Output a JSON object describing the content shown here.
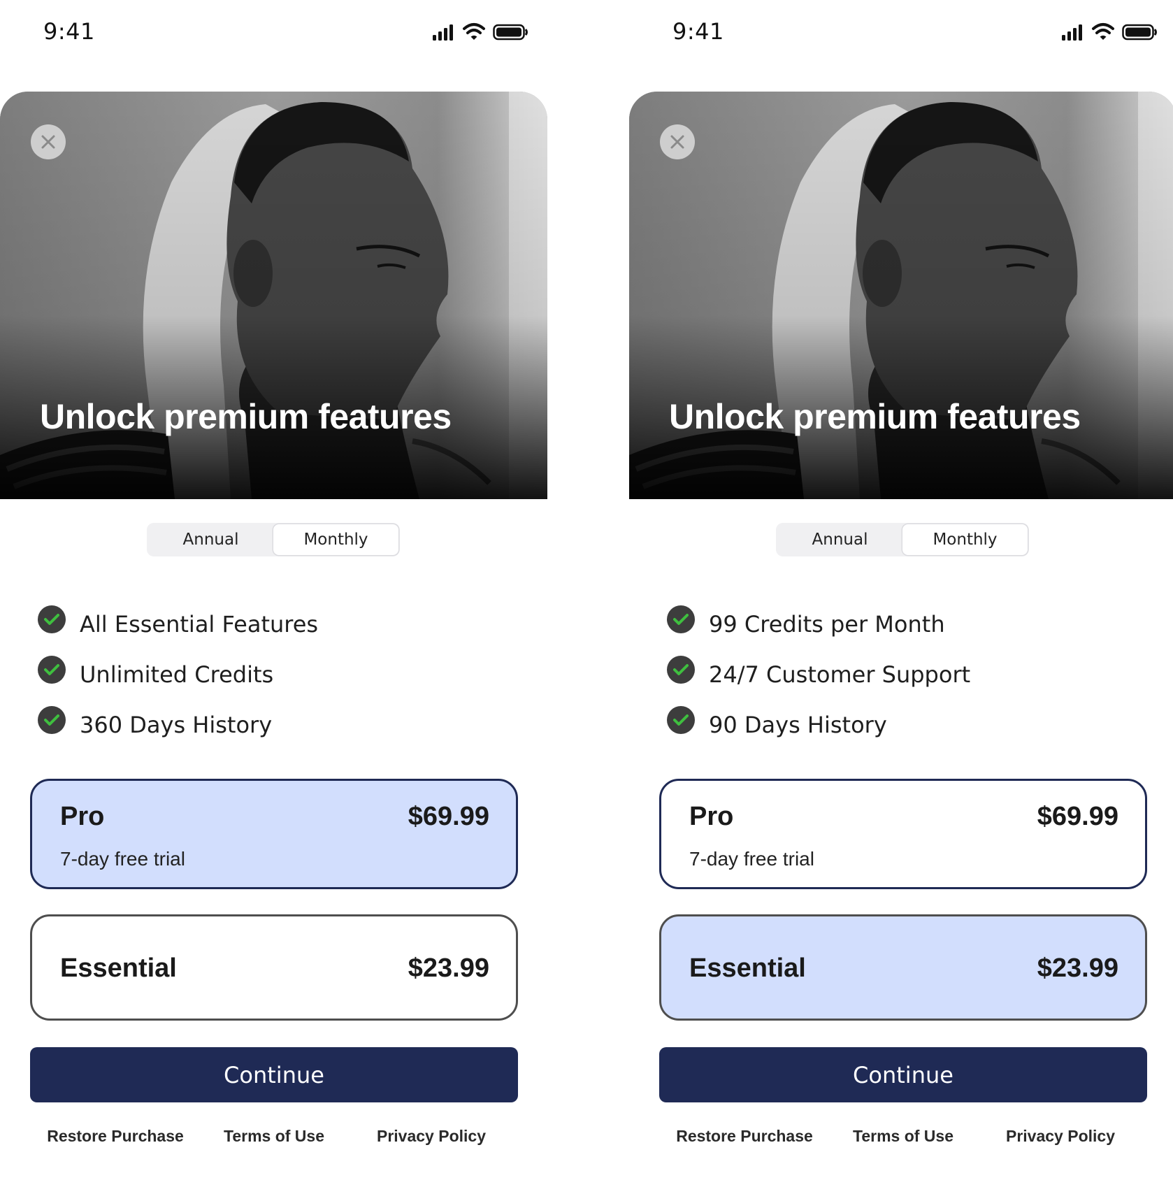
{
  "screens": [
    {
      "status": {
        "time": "9:41"
      },
      "hero_title": "Unlock premium features",
      "toggle": {
        "options": [
          "Annual",
          "Monthly"
        ],
        "selected": "Monthly"
      },
      "features": [
        "All Essential Features",
        "Unlimited Credits",
        "360 Days History"
      ],
      "plans": {
        "pro": {
          "name": "Pro",
          "price": "$69.99",
          "subtitle": "7-day free trial",
          "selected": true
        },
        "essential": {
          "name": "Essential",
          "price": "$23.99",
          "selected": false
        }
      },
      "continue_label": "Continue",
      "footer": {
        "restore": "Restore Purchase",
        "terms": "Terms of Use",
        "privacy": "Privacy Policy"
      }
    },
    {
      "status": {
        "time": "9:41"
      },
      "hero_title": "Unlock premium features",
      "toggle": {
        "options": [
          "Annual",
          "Monthly"
        ],
        "selected": "Monthly"
      },
      "features": [
        "99 Credits per Month",
        "24/7 Customer Support",
        "90 Days History"
      ],
      "plans": {
        "pro": {
          "name": "Pro",
          "price": "$69.99",
          "subtitle": "7-day free trial",
          "selected": false
        },
        "essential": {
          "name": "Essential",
          "price": "$23.99",
          "selected": true
        }
      },
      "continue_label": "Continue",
      "footer": {
        "restore": "Restore Purchase",
        "terms": "Terms of Use",
        "privacy": "Privacy Policy"
      }
    }
  ],
  "icons": {
    "status": [
      "cellular-signal-icon",
      "wifi-icon",
      "battery-icon"
    ],
    "close": "close-icon",
    "check": "checkmark-icon"
  },
  "colors": {
    "accent_navy": "#1f2a55",
    "selected_plan_bg": "#d2defd",
    "check_green": "#3fbf3f",
    "check_circle": "#3d3d3d"
  }
}
